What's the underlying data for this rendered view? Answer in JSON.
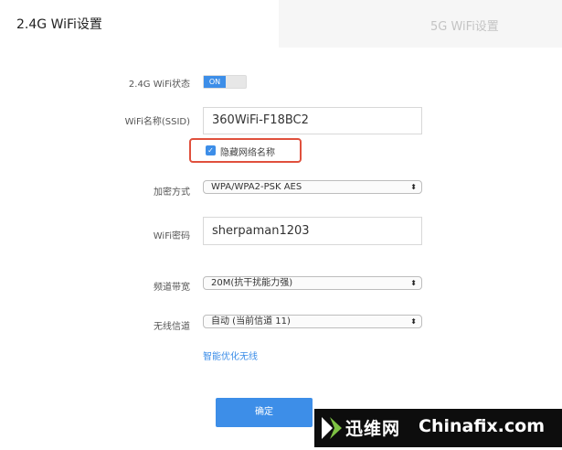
{
  "tabs": {
    "active": "2.4G WiFi设置",
    "inactive": "5G WiFi设置"
  },
  "form": {
    "status": {
      "label": "2.4G WiFi状态",
      "toggle_text": "ON",
      "on": true
    },
    "ssid": {
      "label": "WiFi名称(SSID)",
      "value": "360WiFi-F18BC2"
    },
    "hide_ssid": {
      "label": "隐藏网络名称",
      "checked": true
    },
    "encryption": {
      "label": "加密方式",
      "selected": "WPA/WPA2-PSK AES"
    },
    "password": {
      "label": "WiFi密码",
      "value": "sherpaman1203"
    },
    "bandwidth": {
      "label": "频道带宽",
      "selected": "20M(抗干扰能力强)"
    },
    "channel": {
      "label": "无线信道",
      "selected": "自动 (当前信道 11)"
    },
    "optimize_link": "智能优化无线",
    "confirm_label": "确定"
  },
  "watermark": {
    "cn": "迅维网",
    "en": "Chinafix.com"
  },
  "colors": {
    "accent": "#3d8ee8",
    "highlight": "#e0503d"
  },
  "icons": {
    "select_arrow": "updown-arrow-icon",
    "checkbox": "checkmark-icon"
  }
}
